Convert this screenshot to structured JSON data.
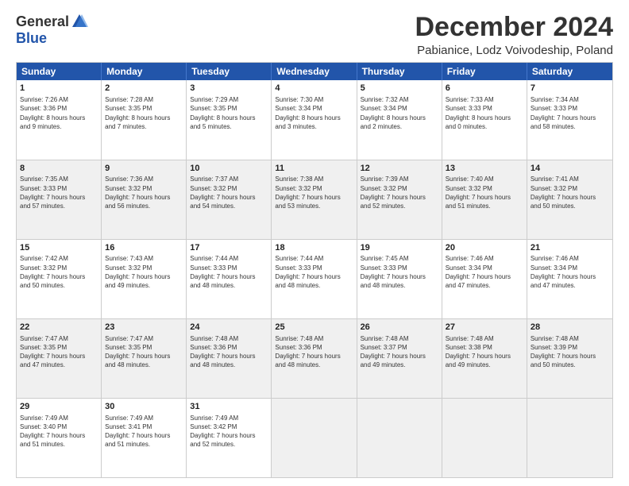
{
  "logo": {
    "general": "General",
    "blue": "Blue"
  },
  "title": "December 2024",
  "subtitle": "Pabianice, Lodz Voivodeship, Poland",
  "header": {
    "days": [
      "Sunday",
      "Monday",
      "Tuesday",
      "Wednesday",
      "Thursday",
      "Friday",
      "Saturday"
    ]
  },
  "weeks": [
    [
      {
        "day": "1",
        "sunrise": "7:26 AM",
        "sunset": "3:36 PM",
        "daylight": "8 hours and 9 minutes."
      },
      {
        "day": "2",
        "sunrise": "7:28 AM",
        "sunset": "3:35 PM",
        "daylight": "8 hours and 7 minutes."
      },
      {
        "day": "3",
        "sunrise": "7:29 AM",
        "sunset": "3:35 PM",
        "daylight": "8 hours and 5 minutes."
      },
      {
        "day": "4",
        "sunrise": "7:30 AM",
        "sunset": "3:34 PM",
        "daylight": "8 hours and 3 minutes."
      },
      {
        "day": "5",
        "sunrise": "7:32 AM",
        "sunset": "3:34 PM",
        "daylight": "8 hours and 2 minutes."
      },
      {
        "day": "6",
        "sunrise": "7:33 AM",
        "sunset": "3:33 PM",
        "daylight": "8 hours and 0 minutes."
      },
      {
        "day": "7",
        "sunrise": "7:34 AM",
        "sunset": "3:33 PM",
        "daylight": "7 hours and 58 minutes."
      }
    ],
    [
      {
        "day": "8",
        "sunrise": "7:35 AM",
        "sunset": "3:33 PM",
        "daylight": "7 hours and 57 minutes."
      },
      {
        "day": "9",
        "sunrise": "7:36 AM",
        "sunset": "3:32 PM",
        "daylight": "7 hours and 56 minutes."
      },
      {
        "day": "10",
        "sunrise": "7:37 AM",
        "sunset": "3:32 PM",
        "daylight": "7 hours and 54 minutes."
      },
      {
        "day": "11",
        "sunrise": "7:38 AM",
        "sunset": "3:32 PM",
        "daylight": "7 hours and 53 minutes."
      },
      {
        "day": "12",
        "sunrise": "7:39 AM",
        "sunset": "3:32 PM",
        "daylight": "7 hours and 52 minutes."
      },
      {
        "day": "13",
        "sunrise": "7:40 AM",
        "sunset": "3:32 PM",
        "daylight": "7 hours and 51 minutes."
      },
      {
        "day": "14",
        "sunrise": "7:41 AM",
        "sunset": "3:32 PM",
        "daylight": "7 hours and 50 minutes."
      }
    ],
    [
      {
        "day": "15",
        "sunrise": "7:42 AM",
        "sunset": "3:32 PM",
        "daylight": "7 hours and 50 minutes."
      },
      {
        "day": "16",
        "sunrise": "7:43 AM",
        "sunset": "3:32 PM",
        "daylight": "7 hours and 49 minutes."
      },
      {
        "day": "17",
        "sunrise": "7:44 AM",
        "sunset": "3:33 PM",
        "daylight": "7 hours and 48 minutes."
      },
      {
        "day": "18",
        "sunrise": "7:44 AM",
        "sunset": "3:33 PM",
        "daylight": "7 hours and 48 minutes."
      },
      {
        "day": "19",
        "sunrise": "7:45 AM",
        "sunset": "3:33 PM",
        "daylight": "7 hours and 48 minutes."
      },
      {
        "day": "20",
        "sunrise": "7:46 AM",
        "sunset": "3:34 PM",
        "daylight": "7 hours and 47 minutes."
      },
      {
        "day": "21",
        "sunrise": "7:46 AM",
        "sunset": "3:34 PM",
        "daylight": "7 hours and 47 minutes."
      }
    ],
    [
      {
        "day": "22",
        "sunrise": "7:47 AM",
        "sunset": "3:35 PM",
        "daylight": "7 hours and 47 minutes."
      },
      {
        "day": "23",
        "sunrise": "7:47 AM",
        "sunset": "3:35 PM",
        "daylight": "7 hours and 48 minutes."
      },
      {
        "day": "24",
        "sunrise": "7:48 AM",
        "sunset": "3:36 PM",
        "daylight": "7 hours and 48 minutes."
      },
      {
        "day": "25",
        "sunrise": "7:48 AM",
        "sunset": "3:36 PM",
        "daylight": "7 hours and 48 minutes."
      },
      {
        "day": "26",
        "sunrise": "7:48 AM",
        "sunset": "3:37 PM",
        "daylight": "7 hours and 49 minutes."
      },
      {
        "day": "27",
        "sunrise": "7:48 AM",
        "sunset": "3:38 PM",
        "daylight": "7 hours and 49 minutes."
      },
      {
        "day": "28",
        "sunrise": "7:48 AM",
        "sunset": "3:39 PM",
        "daylight": "7 hours and 50 minutes."
      }
    ],
    [
      {
        "day": "29",
        "sunrise": "7:49 AM",
        "sunset": "3:40 PM",
        "daylight": "7 hours and 51 minutes."
      },
      {
        "day": "30",
        "sunrise": "7:49 AM",
        "sunset": "3:41 PM",
        "daylight": "7 hours and 51 minutes."
      },
      {
        "day": "31",
        "sunrise": "7:49 AM",
        "sunset": "3:42 PM",
        "daylight": "7 hours and 52 minutes."
      },
      null,
      null,
      null,
      null
    ]
  ]
}
